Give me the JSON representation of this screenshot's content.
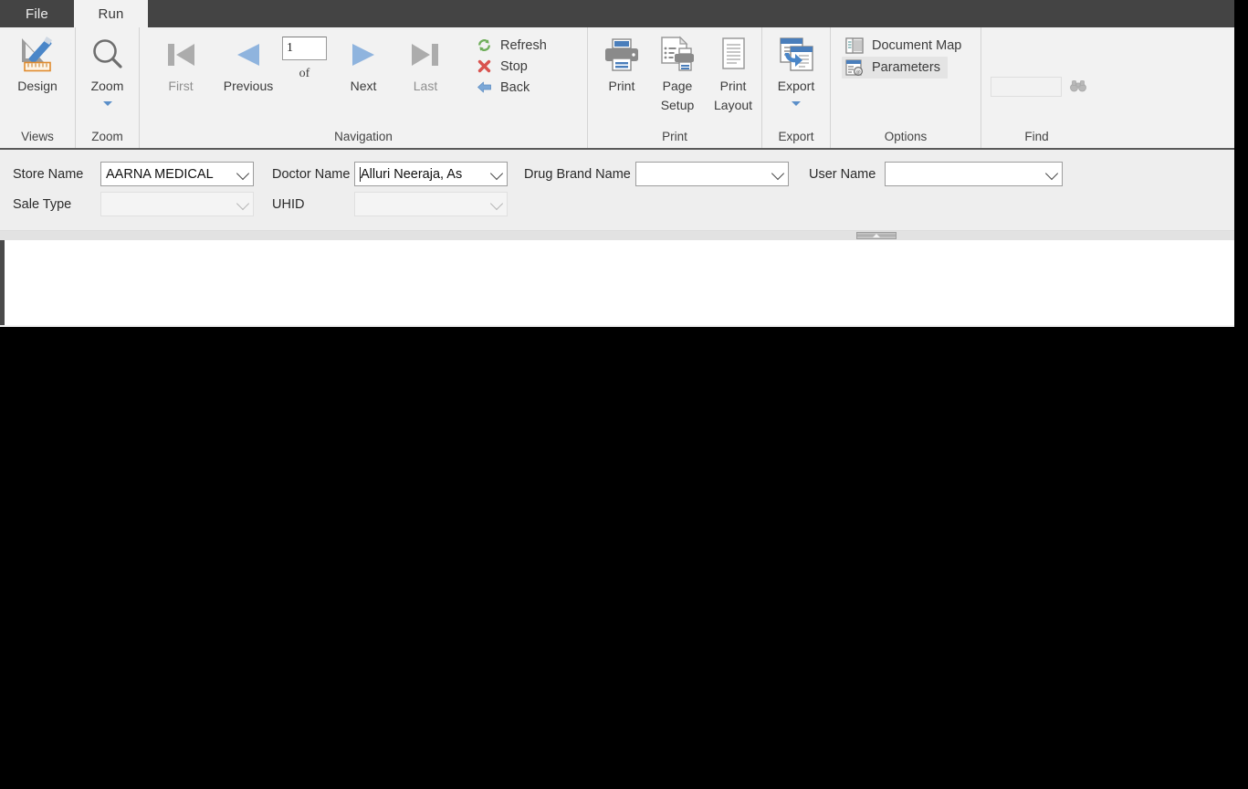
{
  "window": {
    "title": "Report Viewer",
    "accent_blue": "#4a7ebb",
    "chrome_dark": "#444444",
    "panel_bg": "#eeeeee",
    "ribbon_bg": "#f2f2f2"
  },
  "tabs": [
    {
      "label": "File",
      "active": false,
      "name": "tab-file"
    },
    {
      "label": "Run",
      "active": true,
      "name": "tab-run"
    }
  ],
  "ribbon": {
    "groups": [
      {
        "title": "Views"
      },
      {
        "title": "Zoom"
      },
      {
        "title": "Navigation"
      },
      {
        "title": "Print"
      },
      {
        "title": "Export"
      },
      {
        "title": "Options"
      },
      {
        "title": "Find"
      }
    ],
    "views": {
      "design_label": "Design",
      "group_label": "Views"
    },
    "zoom": {
      "zoom_label": "Zoom",
      "group_label": "Zoom"
    },
    "navigation": {
      "first_label": "First",
      "previous_label": "Previous",
      "page_number_value": "1",
      "of_label": "of",
      "total_pages_value": "",
      "next_label": "Next",
      "last_label": "Last",
      "refresh_label": "Refresh",
      "stop_label": "Stop",
      "back_label": "Back",
      "group_label": "Navigation"
    },
    "print": {
      "print_label": "Print",
      "page_setup_label": "Page\nSetup",
      "print_layout_label": "Print\nLayout",
      "group_label": "Print"
    },
    "export": {
      "export_label": "Export",
      "group_label": "Export"
    },
    "options": {
      "document_map_label": "Document Map",
      "parameters_label": "Parameters",
      "group_label": "Options"
    },
    "find": {
      "find_value": "",
      "find_placeholder": "",
      "group_label": "Find"
    }
  },
  "parameters": {
    "store_name": {
      "label": "Store Name",
      "value": "AARNA  MEDICAL",
      "enabled": true
    },
    "doctor_name": {
      "label": "Doctor Name",
      "value": "Alluri  Neeraja, As",
      "enabled": true
    },
    "drug_brand_name": {
      "label": "Drug Brand Name",
      "value": "",
      "enabled": true
    },
    "user_name": {
      "label": "User Name",
      "value": "",
      "enabled": true
    },
    "sale_type": {
      "label": "Sale Type",
      "value": "",
      "enabled": false
    },
    "uhid": {
      "label": "UHID",
      "value": "",
      "enabled": false
    }
  },
  "report": {
    "content": ""
  }
}
